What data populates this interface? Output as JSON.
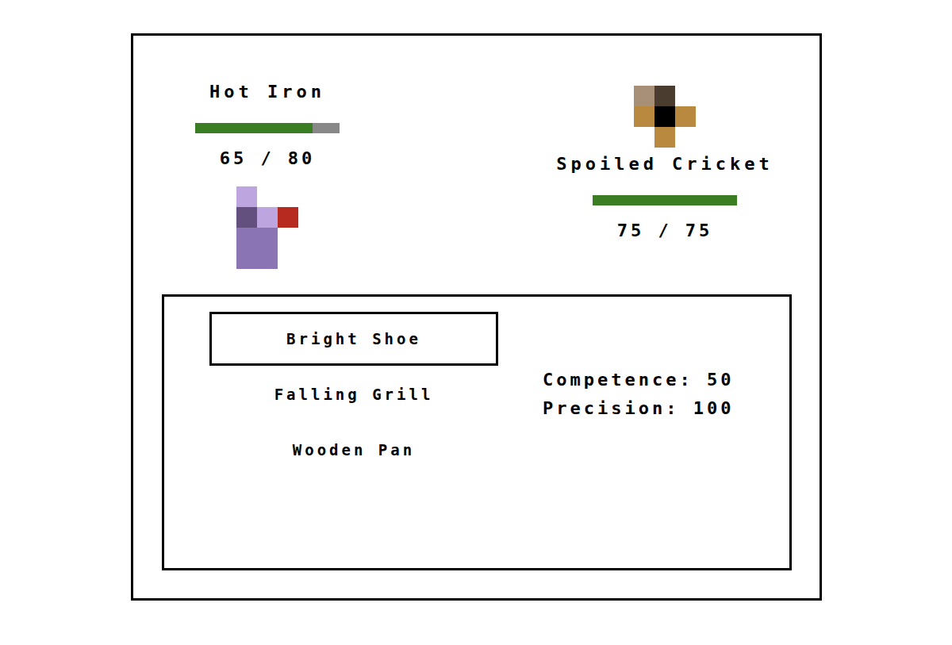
{
  "player": {
    "name": "Hot Iron",
    "hp": {
      "level": 0.8125,
      "reading": "65 / 80"
    }
  },
  "enemy": {
    "name": "Spoiled Cricket",
    "hp": {
      "level": 1,
      "reading": "75 / 75"
    }
  },
  "moves": [
    {
      "label": "Bright Shoe",
      "selected": true
    },
    {
      "label": "Falling Grill",
      "selected": false
    },
    {
      "label": "Wooden Pan",
      "selected": false
    }
  ],
  "stats": [
    "Competence: 50",
    "Precision: 100"
  ]
}
